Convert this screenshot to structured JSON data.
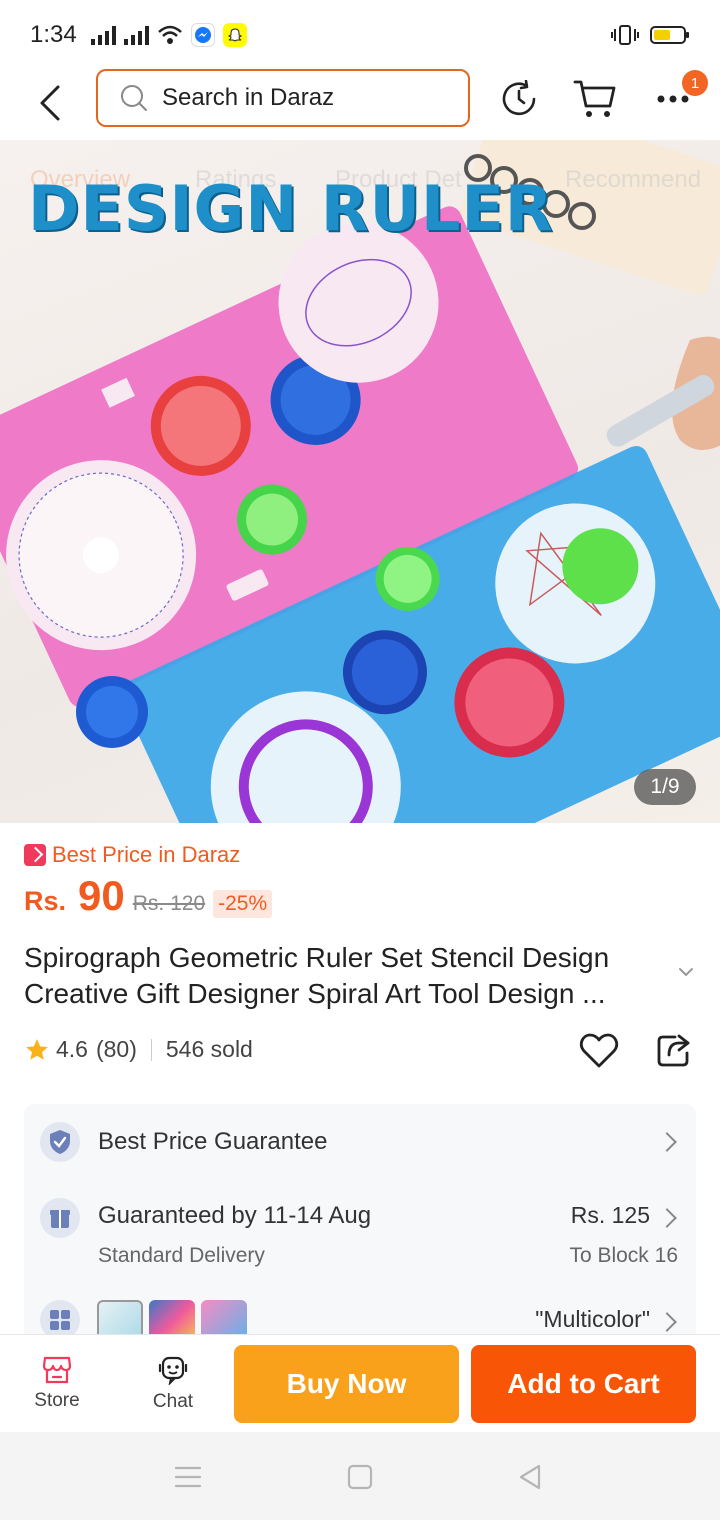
{
  "status_bar": {
    "time": "1:34"
  },
  "header": {
    "search_placeholder": "Search in Daraz",
    "notification_count": "1"
  },
  "hero": {
    "image_caption": "DESIGN RULER",
    "counter": "1/9"
  },
  "product": {
    "badge_text": "Best Price in Daraz",
    "currency": "Rs.",
    "price": "90",
    "original_price": "Rs. 120",
    "discount": "-25%",
    "title": "Spirograph Geometric Ruler Set Stencil Design Creative Gift Designer Spiral Art Tool Design ...",
    "rating": "4.6",
    "review_count": "(80)",
    "sold": "546 sold"
  },
  "info_card": {
    "guarantee": "Best Price Guarantee",
    "delivery_main": "Guaranteed by 11-14 Aug",
    "delivery_sub": "Standard Delivery",
    "delivery_fee": "Rs. 125",
    "delivery_location": "To Block 16",
    "variant_value": "\"Multicolor\""
  },
  "bottom_bar": {
    "store_label": "Store",
    "chat_label": "Chat",
    "buy_now_label": "Buy Now",
    "add_to_cart_label": "Add to Cart"
  },
  "colors": {
    "accent": "#f85606",
    "buy_now": "#f9a11b",
    "price": "#f25b1f"
  }
}
